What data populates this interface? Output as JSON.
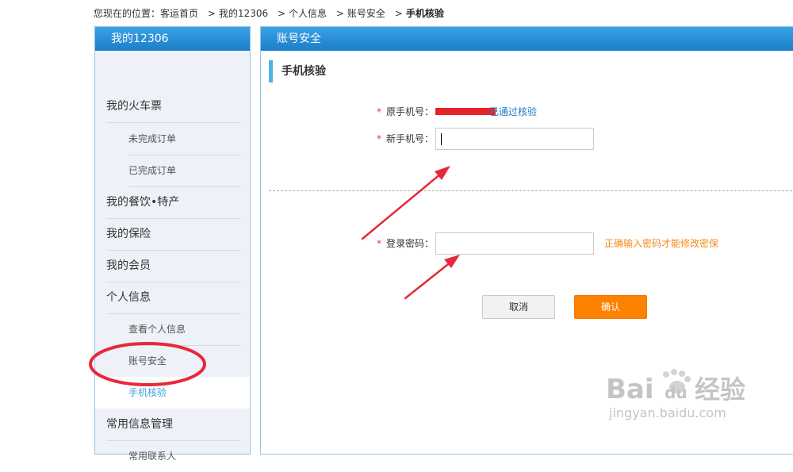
{
  "breadcrumb": {
    "prefix": "您现在的位置：",
    "items": [
      "客运首页",
      "我的12306",
      "个人信息",
      "账号安全"
    ],
    "current": "手机核验",
    "separator": ">"
  },
  "sidebar": {
    "title": "我的12306",
    "items": [
      {
        "label": "我的火车票",
        "level": "top"
      },
      {
        "label": "未完成订单",
        "level": "sub"
      },
      {
        "label": "已完成订单",
        "level": "sub"
      },
      {
        "label": "我的餐饮•特产",
        "level": "top"
      },
      {
        "label": "我的保险",
        "level": "top"
      },
      {
        "label": "我的会员",
        "level": "top"
      },
      {
        "label": "个人信息",
        "level": "top"
      },
      {
        "label": "查看个人信息",
        "level": "sub"
      },
      {
        "label": "账号安全",
        "level": "sub"
      },
      {
        "label": "手机核验",
        "level": "sub",
        "active": true
      },
      {
        "label": "常用信息管理",
        "level": "top"
      },
      {
        "label": "常用联系人",
        "level": "sub"
      }
    ]
  },
  "main": {
    "header": "账号安全",
    "section_title": "手机核验",
    "form": {
      "required_mark": "*",
      "old_phone_label": "原手机号：",
      "old_phone_status": "已通过核验",
      "new_phone_label": "新手机号：",
      "new_phone_value": "",
      "password_label": "登录密码：",
      "password_value": "",
      "password_hint": "正确输入密码才能修改密保"
    },
    "buttons": {
      "cancel": "取消",
      "confirm": "确认"
    }
  },
  "watermark": {
    "brand": "Bai",
    "brand2": "du",
    "suffix": "经验",
    "url": "jingyan.baidu.com"
  },
  "colors": {
    "header_blue": "#1b7dc9",
    "active_text": "#3aa5dc",
    "confirm_orange": "#ff8100",
    "hint_orange": "#f28a1a",
    "annotation_red": "#e8283a"
  }
}
